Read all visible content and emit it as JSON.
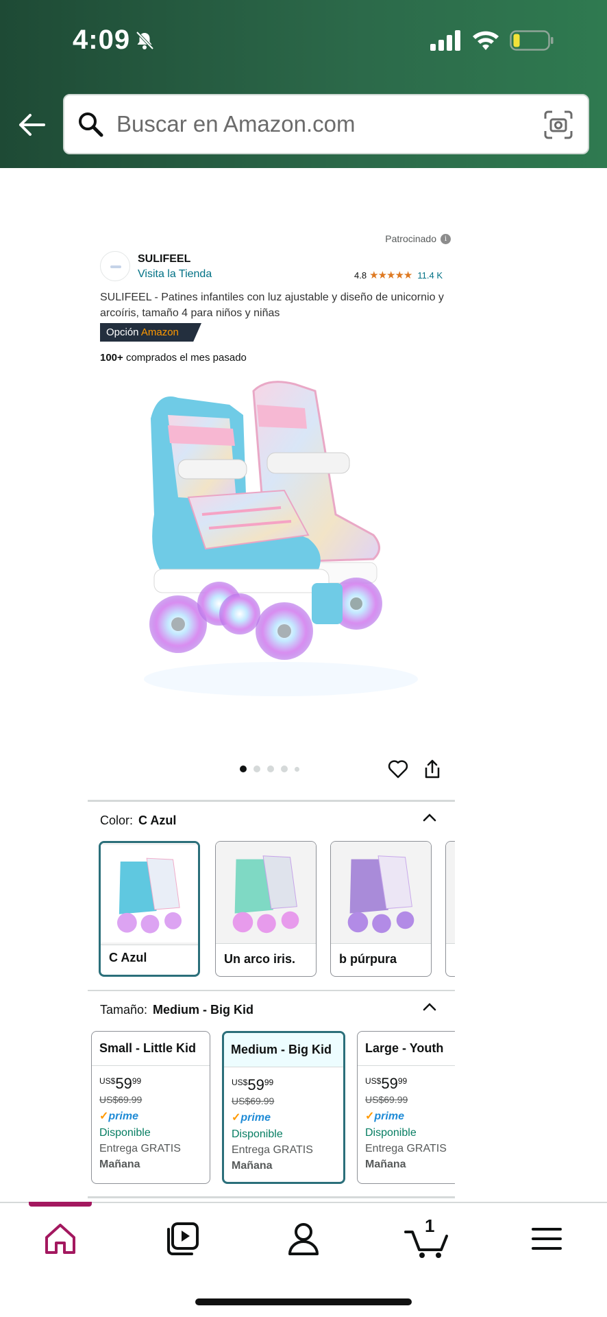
{
  "status_bar": {
    "time": "4:09"
  },
  "search": {
    "placeholder": "Buscar en Amazon.com"
  },
  "product": {
    "sponsored_label": "Patrocinado",
    "brand": "SULIFEEL",
    "store_link": "Visita la Tienda",
    "rating_value": "4.8",
    "stars": "★★★★★",
    "review_count": "11.4 K",
    "title": "SULIFEEL - Patines infantiles con luz ajustable y diseño de unicornio y arcoíris, tamaño 4 para niños y niñas",
    "badge_prefix": "Opción",
    "badge_brand": "Amazon",
    "bought_count": "100+",
    "bought_text": "comprados el mes pasado"
  },
  "carousel": {
    "total_images": 5,
    "active_index": 0
  },
  "color_section": {
    "label": "Color:",
    "selected": "C Azul",
    "options": [
      {
        "label": "C Azul",
        "accent": "#5fc8e0",
        "selected": true
      },
      {
        "label": "Un arco iris.",
        "accent": "#7fd9c4",
        "selected": false
      },
      {
        "label": "b púrpura",
        "accent": "#a98bd9",
        "selected": false
      }
    ]
  },
  "size_section": {
    "label": "Tamaño:",
    "selected": "Medium - Big Kid",
    "options": [
      {
        "name": "Small - Little Kid",
        "currency": "US$",
        "price_whole": "59",
        "price_cents": "99",
        "old_price": "US$69.99",
        "prime": "prime",
        "availability": "Disponible",
        "delivery": "Entrega GRATIS",
        "when": "Mañana",
        "selected": false
      },
      {
        "name": "Medium - Big Kid",
        "currency": "US$",
        "price_whole": "59",
        "price_cents": "99",
        "old_price": "US$69.99",
        "prime": "prime",
        "availability": "Disponible",
        "delivery": "Entrega GRATIS",
        "when": "Mañana",
        "selected": true
      },
      {
        "name": "Large - Youth",
        "currency": "US$",
        "price_whole": "59",
        "price_cents": "99",
        "old_price": "US$69.99",
        "prime": "prime",
        "availability": "Disponible",
        "delivery": "Entrega GRATIS",
        "when": "Mañana",
        "selected": false
      }
    ]
  },
  "bottom_nav": {
    "cart_count": "1",
    "active": "home"
  },
  "colors": {
    "header_green": "#2c6a4a",
    "link": "#007185",
    "star": "#de7921",
    "selected_border": "#2b6f7a",
    "available": "#067d62",
    "home_active": "#a3185f"
  }
}
